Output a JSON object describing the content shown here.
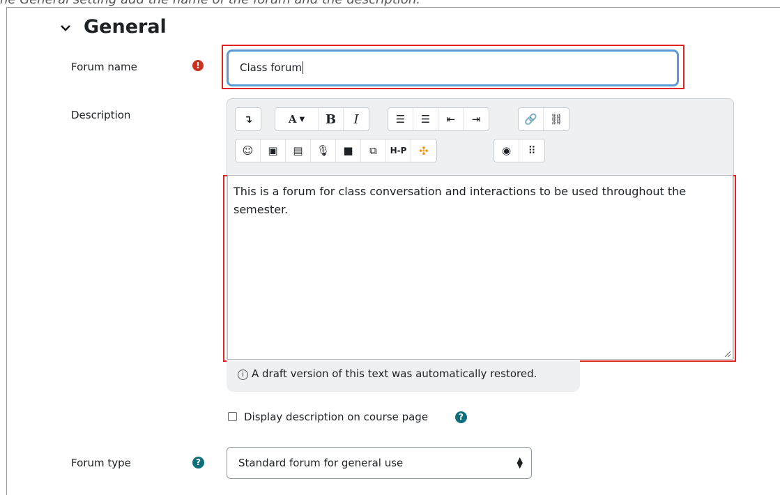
{
  "caption": "he General setting add the name of the forum and the description.",
  "section": {
    "title": "General",
    "chevron_icon": "chevron-down-icon"
  },
  "forum_name": {
    "label": "Forum name",
    "required_icon": "exclamation-icon",
    "value": "Class forum"
  },
  "description": {
    "label": "Description",
    "toolbar_row1": [
      "↴",
      "A▾",
      "B",
      "I",
      "bullet-list",
      "numbered-list",
      "outdent",
      "indent",
      "link",
      "unlink"
    ],
    "toolbar_row2": [
      "emoji",
      "image",
      "media",
      "record-audio",
      "record-video",
      "manage-files",
      "H-P",
      "h5p-content",
      "accessibility-checker",
      "screenreader-helper"
    ],
    "text": "This is a forum for class conversation and interactions to be used throughout the semester.",
    "draft_notice": "A draft version of this text was automatically restored."
  },
  "display_description": {
    "label": "Display description on course page",
    "checked": false
  },
  "forum_type": {
    "label": "Forum type",
    "value": "Standard forum for general use"
  },
  "colors": {
    "required": "#ca3120",
    "help": "#0f6e7c",
    "highlight": "#e02424",
    "focus": "#5b9bd5"
  }
}
